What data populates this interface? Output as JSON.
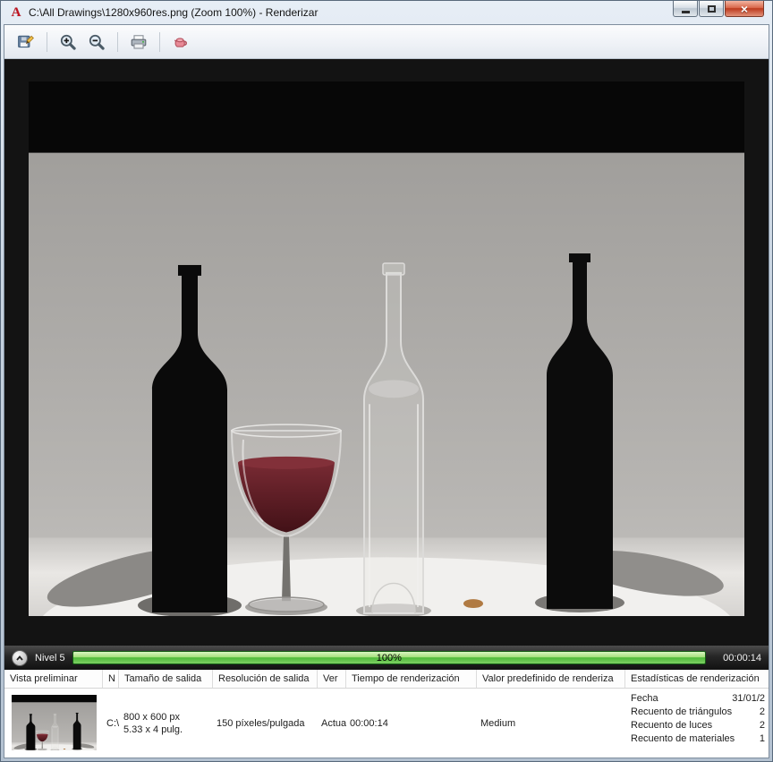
{
  "window": {
    "title": "C:\\All Drawings\\1280x960res.png (Zoom 100%) - Renderizar"
  },
  "toolbar": {
    "buttons": [
      "save",
      "zoom-in",
      "zoom-out",
      "print",
      "purge"
    ]
  },
  "progress": {
    "level": "Nivel 5",
    "percent": "100%",
    "elapsed": "00:00:14"
  },
  "table": {
    "columns": [
      "Vista preliminar",
      "N",
      "Tamaño de salida",
      "Resolución de salida",
      "Ver",
      "Tiempo de renderización",
      "Valor predefinido de renderiza",
      "Estadísticas de renderización"
    ],
    "row": {
      "name": "C:\\...",
      "size_px": "800 x 600 px",
      "size_print": "5.33 x 4 pulg.",
      "resolution": "150 píxeles/pulgada",
      "view": "Actual",
      "time": "00:00:14",
      "preset": "Medium",
      "stats": [
        {
          "label": "Fecha",
          "value": "31/01/2"
        },
        {
          "label": "Recuento de triángulos",
          "value": "2"
        },
        {
          "label": "Recuento de luces",
          "value": "2"
        },
        {
          "label": "Recuento de materiales",
          "value": "1"
        }
      ]
    }
  },
  "colors": {
    "progress_green": "#4eb83a",
    "wine_red": "#5a1e25",
    "logo_red": "#c1121f"
  }
}
